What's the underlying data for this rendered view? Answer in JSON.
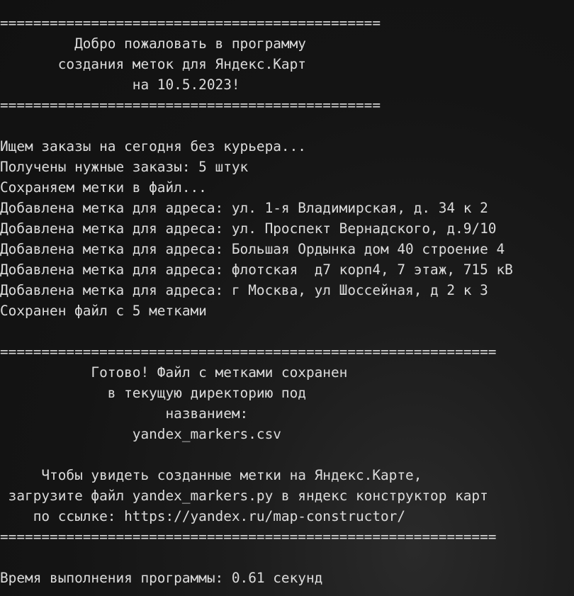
{
  "terminal": {
    "lines": [
      "==============================================",
      "         Добро пожаловать в программу",
      "       создания меток для Яндекс.Карт",
      "                на 10.5.2023!",
      "==============================================",
      "",
      "Ищем заказы на сегодня без курьера...",
      "Получены нужные заказы: 5 штук",
      "Сохраняем метки в файл...",
      "Добавлена метка для адреса: ул. 1-я Владимирская, д. 34 к 2",
      "Добавлена метка для адреса: ул. Проспект Вернадского, д.9/10",
      "Добавлена метка для адреса: Большая Ордынка дом 40 строение 4",
      "Добавлена метка для адреса: флотская  д7 корп4, 7 этаж, 715 кВ",
      "Добавлена метка для адреса: г Москва, ул Шоссейная, д 2 к 3",
      "Сохранен файл с 5 метками",
      "",
      "============================================================",
      "           Готово! Файл с метками сохранен",
      "             в текущую директорию под",
      "                    названием:",
      "                yandex_markers.csv",
      "",
      "     Чтобы увидеть созданные метки на Яндекс.Карте,",
      " загрузите файл yandex_markers.py в яндекс конструктор карт",
      "    по ссылке: https://yandex.ru/map-constructor/",
      "============================================================",
      "",
      "Время выполнения программы: 0.61 секунд"
    ]
  }
}
